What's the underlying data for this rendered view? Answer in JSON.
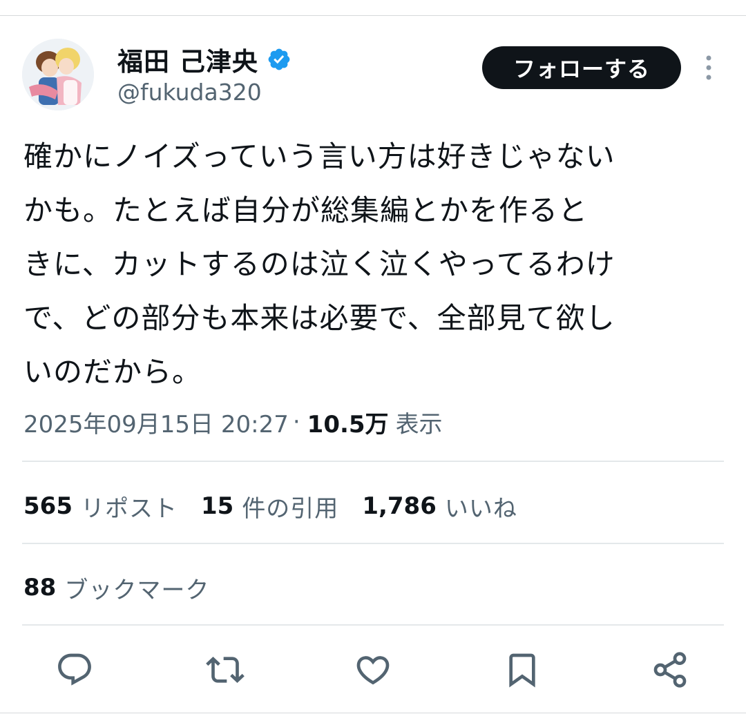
{
  "author": {
    "display_name": "福田 己津央",
    "handle": "@fukuda320",
    "verified_icon": "verified-badge-icon",
    "follow_label": "フォローする"
  },
  "tweet": {
    "text": "確かにノイズっていう言い方は好きじゃない\nかも。たとえば自分が総集編とかを作ると\nきに、カットするのは泣く泣くやってるわけ\nで、どの部分も本来は必要で、全部見て欲し\nいのだから。",
    "timestamp": "2025年09月15日 20:27",
    "separator": "·",
    "views_count": "10.5万",
    "views_label": "表示"
  },
  "stats": {
    "reposts_count": "565",
    "reposts_label": "リポスト",
    "quotes_count": "15",
    "quotes_label": "件の引用",
    "likes_count": "1,786",
    "likes_label": "いいね",
    "bookmarks_count": "88",
    "bookmarks_label": "ブックマーク"
  },
  "actions": [
    "reply-icon",
    "repost-icon",
    "like-icon",
    "bookmark-icon",
    "share-icon"
  ],
  "colors": {
    "text": "#0f1419",
    "secondary_text": "#536471",
    "verified_blue": "#1d9bf0",
    "follow_bg": "#0f1419"
  }
}
